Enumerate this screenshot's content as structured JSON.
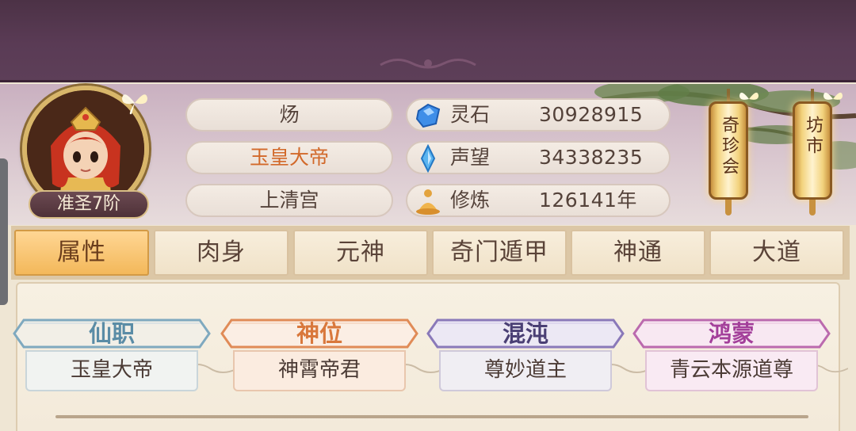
{
  "profile": {
    "name": "炀",
    "title": "玉皇大帝",
    "sect": "上清宫",
    "rank": "准圣7阶"
  },
  "resources": [
    {
      "label": "灵石",
      "value": "30928915",
      "icon": "spirit-stone-icon"
    },
    {
      "label": "声望",
      "value": "34338235",
      "icon": "reputation-crystal-icon"
    },
    {
      "label": "修炼",
      "value": "126141年",
      "icon": "meditation-icon"
    }
  ],
  "buttons": {
    "qizhen": "奇珍会",
    "fangshi": "坊市"
  },
  "tabs": [
    {
      "label": "属性",
      "active": true
    },
    {
      "label": "肉身",
      "active": false
    },
    {
      "label": "元神",
      "active": false
    },
    {
      "label": "奇门遁甲",
      "active": false
    },
    {
      "label": "神通",
      "active": false
    },
    {
      "label": "大道",
      "active": false
    }
  ],
  "ranks": [
    {
      "label": "仙职",
      "value": "玉皇大帝",
      "color": "#5a8ca6"
    },
    {
      "label": "神位",
      "value": "神霄帝君",
      "color": "#d9783c"
    },
    {
      "label": "混沌",
      "value": "尊妙道主",
      "color": "#4a3f74"
    },
    {
      "label": "鸿蒙",
      "value": "青云本源道尊",
      "color": "#a33f9a"
    }
  ]
}
